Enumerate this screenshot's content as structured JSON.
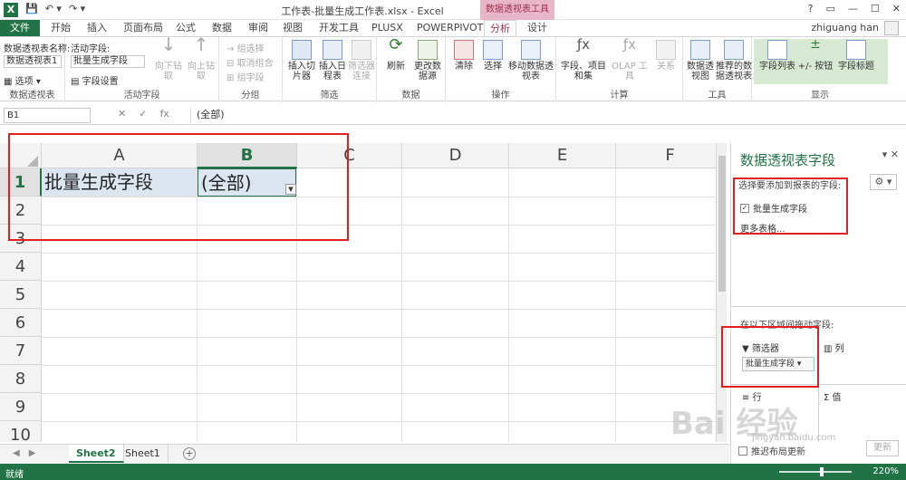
{
  "titlebar": {
    "title": "工作表-批量生成工作表.xlsx - Excel",
    "tool_header": "数据透视表工具",
    "help": "?",
    "qat_save": "💾",
    "qat_undo": "↶ ▾",
    "qat_redo": "↷ ▾"
  },
  "tabs": {
    "file": "文件",
    "items": [
      "开始",
      "插入",
      "页面布局",
      "公式",
      "数据",
      "审阅",
      "视图",
      "开发工具",
      "PLUSX",
      "POWERPIVOT",
      "分析",
      "设计"
    ],
    "user": "zhiguang han"
  },
  "ribbon": {
    "pivot_name_label": "数据透视表名称:",
    "pivot_name_value": "数据透视表1",
    "options": "选项",
    "active_field_label": "活动字段:",
    "active_field_value": "批量生成字段",
    "field_settings": "字段设置",
    "drill_down": "向下钻取",
    "drill_up": "向上钻取",
    "group_selection": "组选择",
    "ungroup": "取消组合",
    "group_field": "组字段",
    "insert_slicer": "插入切片器",
    "insert_timeline": "插入日程表",
    "filter_connections": "筛选器连接",
    "refresh": "刷新",
    "change_source": "更改数据源",
    "clear": "清除",
    "select": "选择",
    "move_pivot": "移动数据透视表",
    "fields_items": "字段、项目和集",
    "olap_tools": "OLAP 工具",
    "relationships": "关系",
    "pivot_chart": "数据透视图",
    "recommended": "推荐的数据透视表",
    "field_list": "字段列表",
    "buttons": "+/- 按钮",
    "field_headers": "字段标题",
    "groups": {
      "pivot": "数据透视表",
      "active_field": "活动字段",
      "group": "分组",
      "filter": "筛选",
      "data": "数据",
      "actions": "操作",
      "calc": "计算",
      "tools": "工具",
      "show": "显示"
    }
  },
  "formula": {
    "name_box": "B1",
    "value": "(全部)",
    "cancel": "✕",
    "enter": "✓",
    "fx": "fx"
  },
  "grid": {
    "columns": [
      "A",
      "B",
      "C",
      "D",
      "E",
      "F"
    ],
    "rows": [
      "1",
      "2",
      "3",
      "4",
      "5",
      "6",
      "7",
      "8",
      "9",
      "10"
    ],
    "a1": "批量生成字段",
    "b1": "(全部)"
  },
  "sheets": {
    "tabs": [
      "Sheet2",
      "Sheet1"
    ],
    "active": "Sheet2"
  },
  "status": {
    "ready": "就绪",
    "zoom": "220%"
  },
  "pane": {
    "title": "数据透视表字段",
    "subtitle": "选择要添加到报表的字段:",
    "field": "批量生成字段",
    "more_tables": "更多表格...",
    "drag_hint": "在以下区域间拖动字段:",
    "filters": "筛选器",
    "columns": "列",
    "rows": "行",
    "values": "值",
    "filter_item": "批量生成字段",
    "defer": "推迟布局更新",
    "update": "更新"
  },
  "watermark": {
    "text": "Bai 经验",
    "sub": "jingyan.baidu.com"
  },
  "colors": {
    "excel_green": "#217346",
    "annotation_red": "#e02020",
    "tool_pink": "#e7b6c8"
  }
}
